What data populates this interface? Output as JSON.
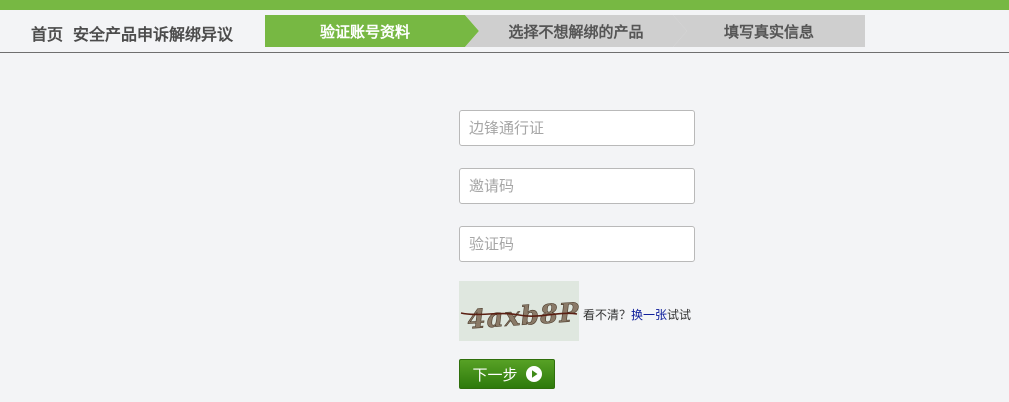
{
  "header": {
    "breadcrumb": {
      "home": "首页",
      "section": "安全产品申诉解绑异议"
    },
    "steps": [
      {
        "label": "验证账号资料",
        "active": true
      },
      {
        "label": "选择不想解绑的产品",
        "active": false
      },
      {
        "label": "填写真实信息",
        "active": false
      }
    ]
  },
  "form": {
    "passport": {
      "value": "",
      "placeholder": "边锋通行证"
    },
    "invite_code": {
      "value": "",
      "placeholder": "邀请码"
    },
    "captcha_code": {
      "value": "",
      "placeholder": "验证码"
    },
    "captcha": {
      "image_text": "4axb8P",
      "hint_prefix": "看不清？",
      "refresh_link": "换一张",
      "hint_suffix": "试试"
    },
    "next_button": "下一步"
  },
  "colors": {
    "accent_green": "#77b843",
    "inactive_step": "#cfcfcf",
    "button_green": "#3e8a16",
    "link_blue": "#0a1a9a",
    "background": "#f3f4f6"
  },
  "icons": {
    "next": "play-circle-icon"
  }
}
